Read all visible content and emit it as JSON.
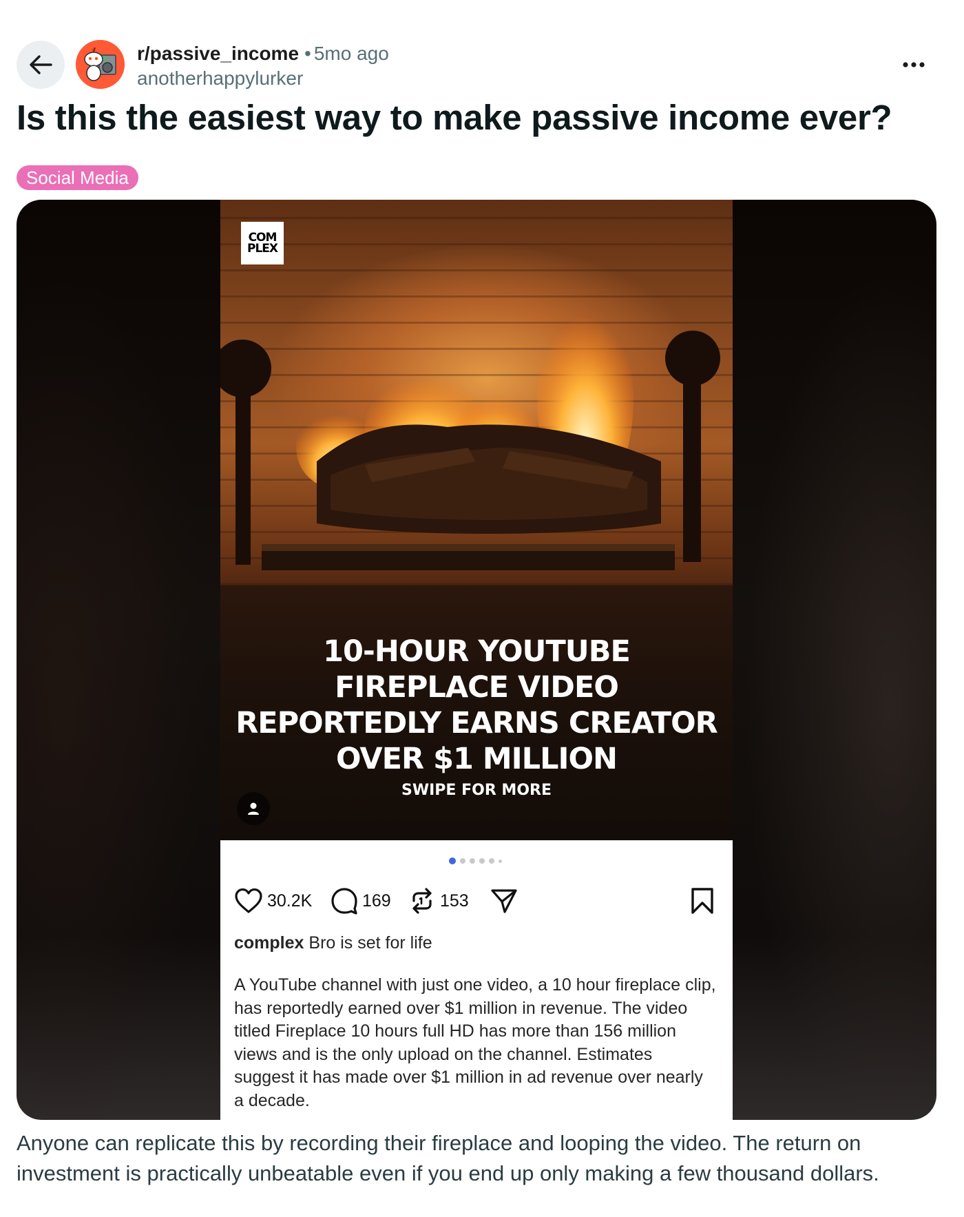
{
  "header": {
    "back_icon": "arrow-left-icon",
    "subreddit": "r/passive_income",
    "separator": "•",
    "age": "5mo ago",
    "username": "anotherhappylurker",
    "more_icon": "more-horizontal-icon"
  },
  "post": {
    "title": "Is this the easiest way to make passive income ever?",
    "flair": "Social Media",
    "flair_color": "#ea6fb7",
    "body": "Anyone can replicate this by recording their fireplace and looping the video. The return on investment is practically unbeatable even if you end up only making a few thousand dollars."
  },
  "media": {
    "logo_line1": "COM",
    "logo_line2": "PLEX",
    "headline": "10-HOUR YOUTUBE FIREPLACE VIDEO REPORTEDLY EARNS CREATOR OVER $1 MILLION",
    "swipe_text": "SWIPE FOR MORE",
    "carousel_total": 6,
    "carousel_active": 1,
    "actions": {
      "likes": "30.2K",
      "comments": "169",
      "reposts": "153"
    },
    "caption_user": "complex",
    "caption_text": "Bro is set for life",
    "description": "A YouTube channel with just one video, a 10 hour fireplace clip, has reportedly earned over $1 million in revenue. The video titled Fireplace 10 hours full HD has more than 156 million views and is the only upload on the channel. Estimates suggest it has made over $1 million in ad revenue over nearly a decade."
  },
  "colors": {
    "accent_dot": "#3d66e0",
    "title_text": "#0f1a1c",
    "meta_text": "#576f76"
  }
}
